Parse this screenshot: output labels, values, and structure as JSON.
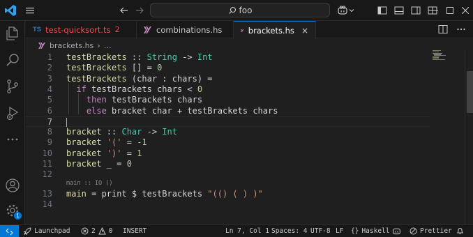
{
  "titlebar": {
    "search_text": "foo",
    "icons": [
      "vscode-logo-icon",
      "menu-icon",
      "back-arrow-icon",
      "forward-arrow-icon",
      "search-icon",
      "copilot-icon",
      "toggle-primary-sidebar-icon",
      "toggle-panel-icon",
      "toggle-secondary-sidebar-icon",
      "customize-layout-icon",
      "minimize-icon",
      "maximize-icon",
      "close-icon"
    ]
  },
  "activity_bar": {
    "items": [
      "explorer-icon",
      "search-icon",
      "source-control-icon",
      "run-debug-icon",
      "more-icon"
    ],
    "bottom": [
      "account-icon",
      "manage-gear-icon"
    ],
    "manage_badge": "1"
  },
  "tabs": [
    {
      "prefix": "TS",
      "label": "test-quicksort.ts",
      "problems": "2"
    },
    {
      "label": "combinations.hs"
    },
    {
      "label": "brackets.hs",
      "close": "×"
    }
  ],
  "breadcrumb": {
    "file": "brackets.hs",
    "separator": "›",
    "rest": "…"
  },
  "editor": {
    "line_numbers": [
      "1",
      "2",
      "3",
      "4",
      "5",
      "6",
      "7",
      "8",
      "9",
      "10",
      "11",
      "12",
      "13",
      "14"
    ],
    "inlay_hint": "main :: IO ()",
    "current_line": "7",
    "lines": [
      [
        {
          "t": "testBrackets",
          "c": "fn"
        },
        {
          "t": " :: ",
          "c": "op"
        },
        {
          "t": "String",
          "c": "ty"
        },
        {
          "t": " -> ",
          "c": "op"
        },
        {
          "t": "Int",
          "c": "ty"
        }
      ],
      [
        {
          "t": "testBrackets",
          "c": "fn"
        },
        {
          "t": " [] = ",
          "c": "op"
        },
        {
          "t": "0",
          "c": "num"
        }
      ],
      [
        {
          "t": "testBrackets",
          "c": "fn"
        },
        {
          "t": " (char : chars) =",
          "c": "var"
        }
      ],
      [
        {
          "t": "  ",
          "c": "var"
        },
        {
          "t": "if",
          "c": "kw"
        },
        {
          "t": " testBrackets chars < ",
          "c": "var"
        },
        {
          "t": "0",
          "c": "num"
        }
      ],
      [
        {
          "t": "    ",
          "c": "var"
        },
        {
          "t": "then",
          "c": "kw"
        },
        {
          "t": " testBrackets chars",
          "c": "var"
        }
      ],
      [
        {
          "t": "    ",
          "c": "var"
        },
        {
          "t": "else",
          "c": "kw"
        },
        {
          "t": " bracket char + testBrackets chars",
          "c": "var"
        }
      ],
      [],
      [
        {
          "t": "bracket",
          "c": "fn"
        },
        {
          "t": " :: ",
          "c": "op"
        },
        {
          "t": "Char",
          "c": "ty"
        },
        {
          "t": " -> ",
          "c": "op"
        },
        {
          "t": "Int",
          "c": "ty"
        }
      ],
      [
        {
          "t": "bracket",
          "c": "fn"
        },
        {
          "t": " ",
          "c": "op"
        },
        {
          "t": "'('",
          "c": "str"
        },
        {
          "t": " = ",
          "c": "op"
        },
        {
          "t": "-1",
          "c": "num"
        }
      ],
      [
        {
          "t": "bracket",
          "c": "fn"
        },
        {
          "t": " ",
          "c": "op"
        },
        {
          "t": "')'",
          "c": "str"
        },
        {
          "t": " = ",
          "c": "op"
        },
        {
          "t": "1",
          "c": "num"
        }
      ],
      [
        {
          "t": "bracket",
          "c": "fn"
        },
        {
          "t": " _ = ",
          "c": "op"
        },
        {
          "t": "0",
          "c": "num"
        }
      ],
      [],
      [
        {
          "t": "main",
          "c": "fn"
        },
        {
          "t": " = print $ testBrackets ",
          "c": "var"
        },
        {
          "t": "\"(() ( ) )\"",
          "c": "str"
        }
      ],
      []
    ]
  },
  "statusbar": {
    "launchpad": "Launchpad",
    "errors": "2",
    "warnings": "0",
    "mode": "INSERT",
    "position": "Ln 7, Col 1",
    "spaces": "Spaces: 4",
    "encoding": "UTF-8",
    "eol": "LF",
    "language": "Haskell",
    "prettier": "Prettier"
  },
  "colors": {
    "accent": "#0078d4",
    "function": "#dcdcaa",
    "type": "#4ec9b0",
    "keyword": "#c586c0",
    "number": "#b5cea8",
    "string": "#ce9178",
    "error": "#f14c4c"
  }
}
